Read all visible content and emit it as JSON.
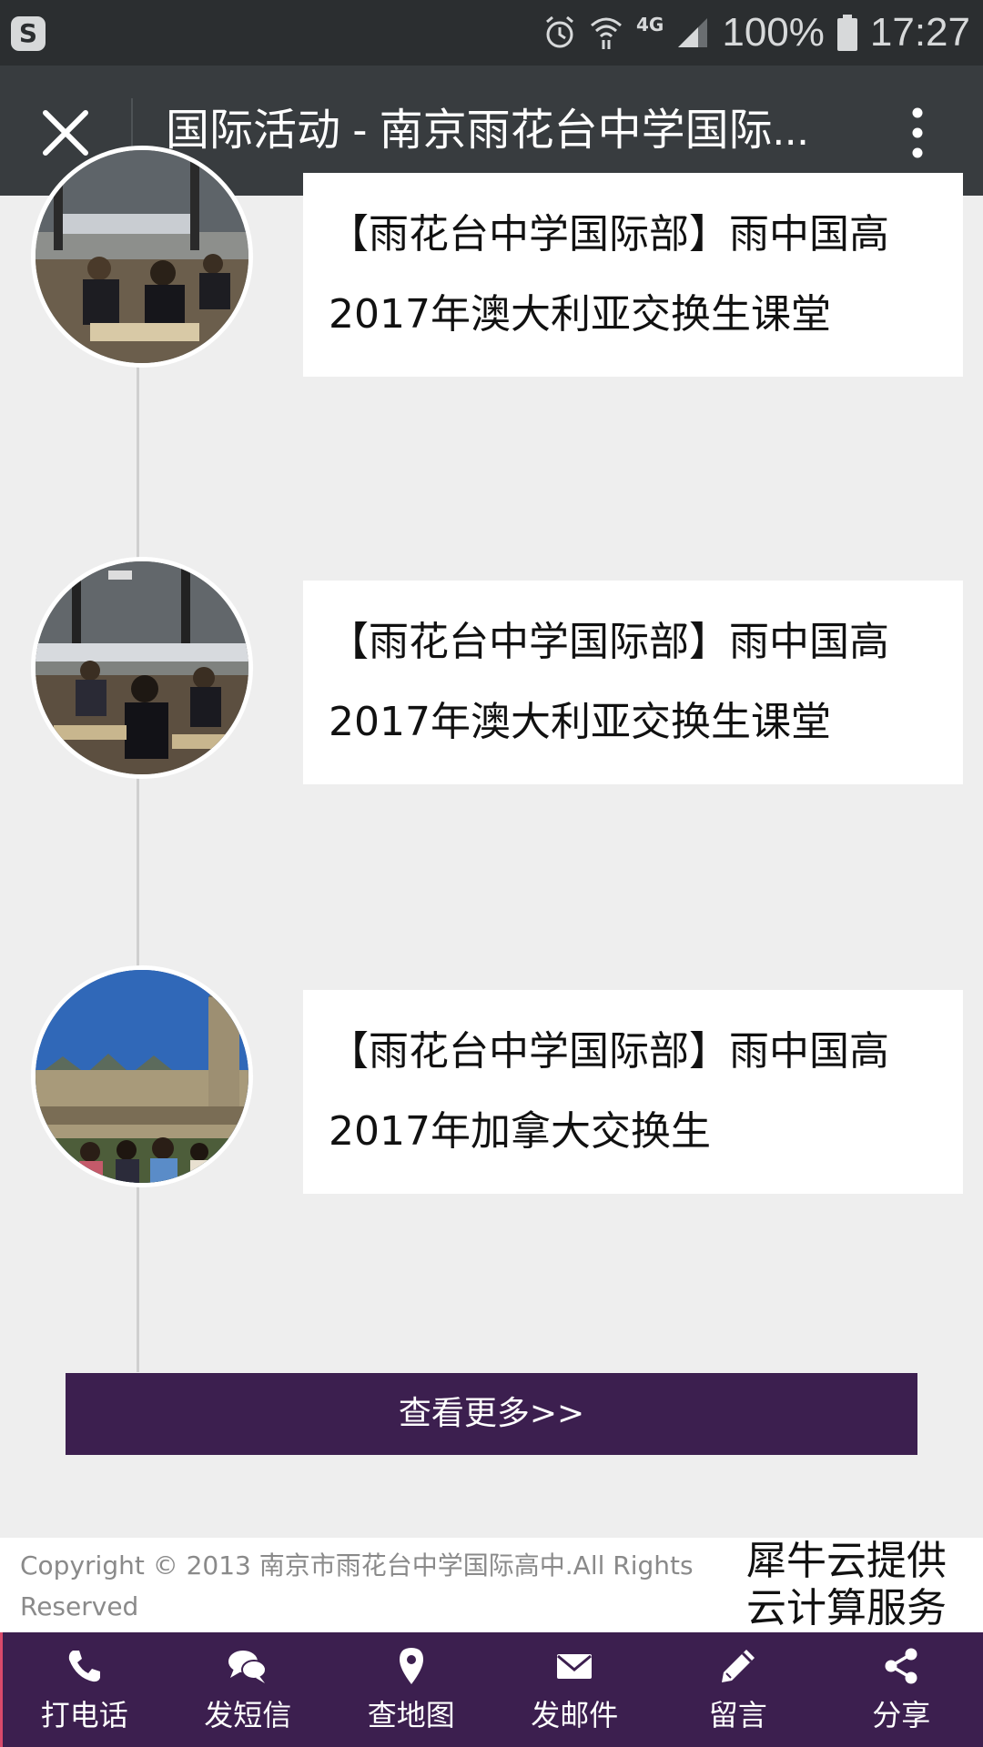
{
  "status_bar": {
    "network": "4G",
    "battery": "100%",
    "time": "17:27"
  },
  "title_bar": {
    "title": "国际活动 - 南京雨花台中学国际..."
  },
  "timeline": {
    "items": [
      {
        "line1": "【雨花台中学国际部】雨中国高",
        "line2": "2017年澳大利亚交换生课堂",
        "photo": "classroom-photo"
      },
      {
        "line1": "【雨花台中学国际部】雨中国高",
        "line2": "2017年澳大利亚交换生课堂",
        "photo": "classroom-photo"
      },
      {
        "line1": "【雨花台中学国际部】雨中国高",
        "line2": "2017年加拿大交换生",
        "photo": "parliament-photo"
      }
    ]
  },
  "more_button": {
    "label": "查看更多>>"
  },
  "footer": {
    "copyright_line1": "Copyright © 2013 南京市雨花台中学国际高中.All Rights",
    "copyright_line2": "Reserved",
    "provider_line1": "犀牛云提供",
    "provider_line2": "云计算服务"
  },
  "bottom_nav": {
    "items": [
      {
        "label": "打电话",
        "icon": "phone-icon"
      },
      {
        "label": "发短信",
        "icon": "chat-icon"
      },
      {
        "label": "查地图",
        "icon": "map-pin-icon"
      },
      {
        "label": "发邮件",
        "icon": "mail-icon"
      },
      {
        "label": "留言",
        "icon": "pencil-icon"
      },
      {
        "label": "分享",
        "icon": "share-icon"
      }
    ]
  },
  "colors": {
    "accent_purple": "#3c1f4f",
    "title_bar": "#383c3f",
    "status_bar": "#2b2e30",
    "page_bg": "#eeeeee"
  }
}
